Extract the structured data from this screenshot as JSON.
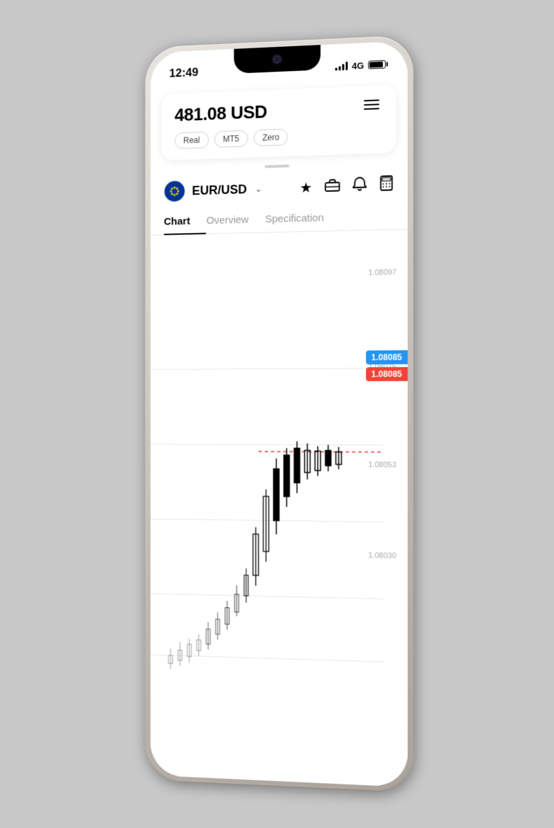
{
  "status_bar": {
    "time": "12:49",
    "network": "4G"
  },
  "account": {
    "balance": "481.08 USD",
    "tags": [
      "Real",
      "MT5",
      "Zero"
    ],
    "hamburger_label": "menu"
  },
  "instrument": {
    "name": "EUR/USD",
    "flag": "EU"
  },
  "tabs": [
    {
      "id": "chart",
      "label": "Chart",
      "active": true
    },
    {
      "id": "overview",
      "label": "Overview",
      "active": false
    },
    {
      "id": "specification",
      "label": "Specification",
      "active": false
    }
  ],
  "chart": {
    "price_levels": [
      {
        "id": "p1",
        "value": "1.08097"
      },
      {
        "id": "p2",
        "value": "1.08085"
      },
      {
        "id": "p3",
        "value": "1.08075"
      },
      {
        "id": "p4",
        "value": "1.08053"
      },
      {
        "id": "p5",
        "value": "1.08030"
      }
    ],
    "current_price_ask": "1.08085",
    "current_price_bid": "1.08085",
    "dotted_line_color": "#e53935",
    "grid_color": "#e8e8e8"
  },
  "icons": {
    "star": "★",
    "briefcase": "💼",
    "bell": "🔔",
    "calculator": "🖩",
    "chevron": "∨"
  }
}
